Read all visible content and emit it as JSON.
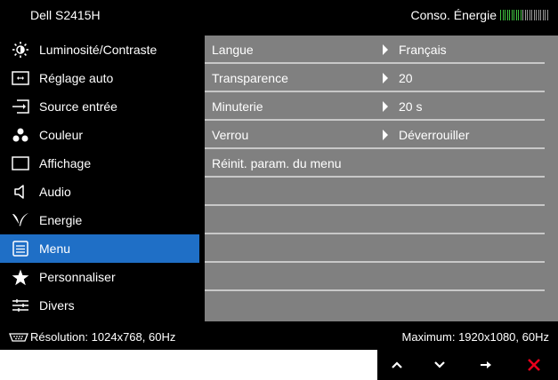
{
  "header": {
    "model": "Dell S2415H",
    "energy_label": "Conso. Énergie",
    "energy_level": 0.45,
    "colors": {
      "energy_on": "#3fbf3f",
      "energy_off": "#9a9a9a"
    }
  },
  "sidebar": {
    "active_color": "#1f6fc6",
    "items": [
      {
        "label": "Luminosité/Contraste",
        "icon": "brightness-icon"
      },
      {
        "label": "Réglage auto",
        "icon": "auto-adjust-icon"
      },
      {
        "label": "Source entrée",
        "icon": "input-source-icon"
      },
      {
        "label": "Couleur",
        "icon": "color-dots-icon"
      },
      {
        "label": "Affichage",
        "icon": "display-icon"
      },
      {
        "label": "Audio",
        "icon": "speaker-icon"
      },
      {
        "label": "Energie",
        "icon": "energy-icon"
      },
      {
        "label": "Menu",
        "icon": "menu-icon",
        "active": true
      },
      {
        "label": "Personnaliser",
        "icon": "star-icon"
      },
      {
        "label": "Divers",
        "icon": "others-icon"
      }
    ]
  },
  "menu_panel": {
    "rows": [
      {
        "label": "Langue",
        "value": "Français"
      },
      {
        "label": "Transparence",
        "value": "20"
      },
      {
        "label": "Minuterie",
        "value": "20 s"
      },
      {
        "label": "Verrou",
        "value": "Déverrouiller"
      },
      {
        "label": "Réinit. param. du menu",
        "value": ""
      },
      {
        "label": "",
        "value": ""
      },
      {
        "label": "",
        "value": ""
      },
      {
        "label": "",
        "value": ""
      },
      {
        "label": "",
        "value": ""
      },
      {
        "label": "",
        "value": ""
      }
    ]
  },
  "status": {
    "resolution": "Résolution: 1024x768, 60Hz",
    "maximum": "Maximum: 1920x1080, 60Hz"
  },
  "nav_buttons": [
    {
      "icon": "arrow-up-icon"
    },
    {
      "icon": "arrow-down-icon"
    },
    {
      "icon": "arrow-right-icon"
    },
    {
      "icon": "close-icon",
      "color": "#e8001c"
    }
  ]
}
